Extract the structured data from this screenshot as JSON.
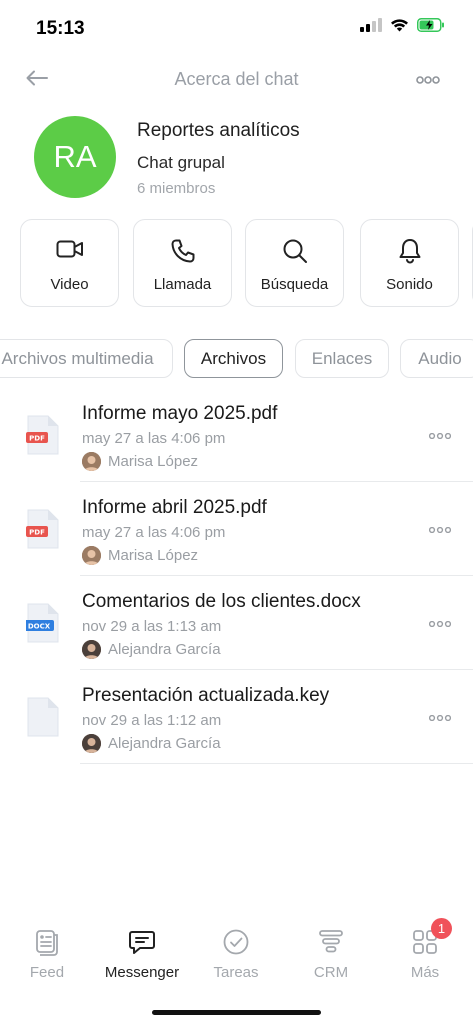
{
  "status_bar": {
    "time": "15:13",
    "icons": [
      "signal-icon",
      "wifi-icon",
      "battery-charging-icon"
    ]
  },
  "header": {
    "title": "Acerca del chat",
    "back_icon": "arrow-left-icon",
    "more_icon": "more-dots-icon"
  },
  "chat": {
    "avatar_initials": "RA",
    "avatar_color": "#5ccc47",
    "name": "Reportes analíticos",
    "type": "Chat grupal",
    "members": "6 miembros"
  },
  "actions": [
    {
      "label": "Video",
      "icon": "video-camera-icon"
    },
    {
      "label": "Llamada",
      "icon": "phone-icon"
    },
    {
      "label": "Búsqueda",
      "icon": "search-icon"
    },
    {
      "label": "Sonido",
      "icon": "bell-icon"
    }
  ],
  "tabs": [
    {
      "label": "Archivos multimedia",
      "active": false
    },
    {
      "label": "Archivos",
      "active": true
    },
    {
      "label": "Enlaces",
      "active": false
    },
    {
      "label": "Audio",
      "active": false
    }
  ],
  "files": [
    {
      "name": "Informe mayo 2025.pdf",
      "date": "may 27 a las 4:06 pm",
      "author": "Marisa López",
      "type": "PDF",
      "type_color": "#e8544e"
    },
    {
      "name": "Informe abril 2025.pdf",
      "date": "may 27 a las 4:06 pm",
      "author": "Marisa López",
      "type": "PDF",
      "type_color": "#e8544e"
    },
    {
      "name": "Comentarios de los clientes.docx",
      "date": "nov 29 a las 1:13 am",
      "author": "Alejandra García",
      "type": "DOCX",
      "type_color": "#2f7fe0"
    },
    {
      "name": "Presentación actualizada.key",
      "date": "nov 29 a las 1:12 am",
      "author": "Alejandra García",
      "type": "",
      "type_color": ""
    }
  ],
  "bottom_nav": [
    {
      "label": "Feed",
      "icon": "feed-icon",
      "active": false
    },
    {
      "label": "Messenger",
      "icon": "chat-bubble-icon",
      "active": true
    },
    {
      "label": "Tareas",
      "icon": "check-circle-icon",
      "active": false
    },
    {
      "label": "CRM",
      "icon": "funnel-icon",
      "active": false
    },
    {
      "label": "Más",
      "icon": "grid-icon",
      "active": false,
      "badge": "1"
    }
  ],
  "colors": {
    "accent_green": "#5ccc47",
    "badge_red": "#f0525a",
    "battery_green": "#34c759"
  }
}
